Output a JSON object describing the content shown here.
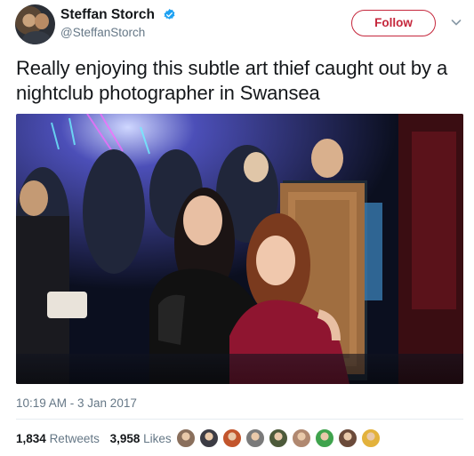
{
  "author": {
    "display_name": "Steffan Storch",
    "handle": "@SteffanStorch"
  },
  "icons": {
    "verified": "verified-badge-icon",
    "chevron": "chevron-down-icon"
  },
  "follow_label": "Follow",
  "tweet": {
    "text": "Really enjoying this subtle art thief caught out by a nightclub photographer in Swansea",
    "timestamp": "10:19 AM - 3 Jan 2017"
  },
  "stats": {
    "retweets_count": "1,834",
    "retweets_label": "Retweets",
    "likes_count": "3,958",
    "likes_label": "Likes"
  },
  "likers": [
    {
      "color": "#8a6f5c"
    },
    {
      "color": "#3c3c44"
    },
    {
      "color": "#c2552c"
    },
    {
      "color": "#7a7a7a"
    },
    {
      "color": "#4d5a3a"
    },
    {
      "color": "#b08870"
    },
    {
      "color": "#3fa34d"
    },
    {
      "color": "#6b4a3a"
    },
    {
      "color": "#e3b23c"
    }
  ],
  "colors": {
    "follow_accent": "#c5273c",
    "verified_blue": "#1da1f2",
    "secondary_text": "#657786"
  }
}
